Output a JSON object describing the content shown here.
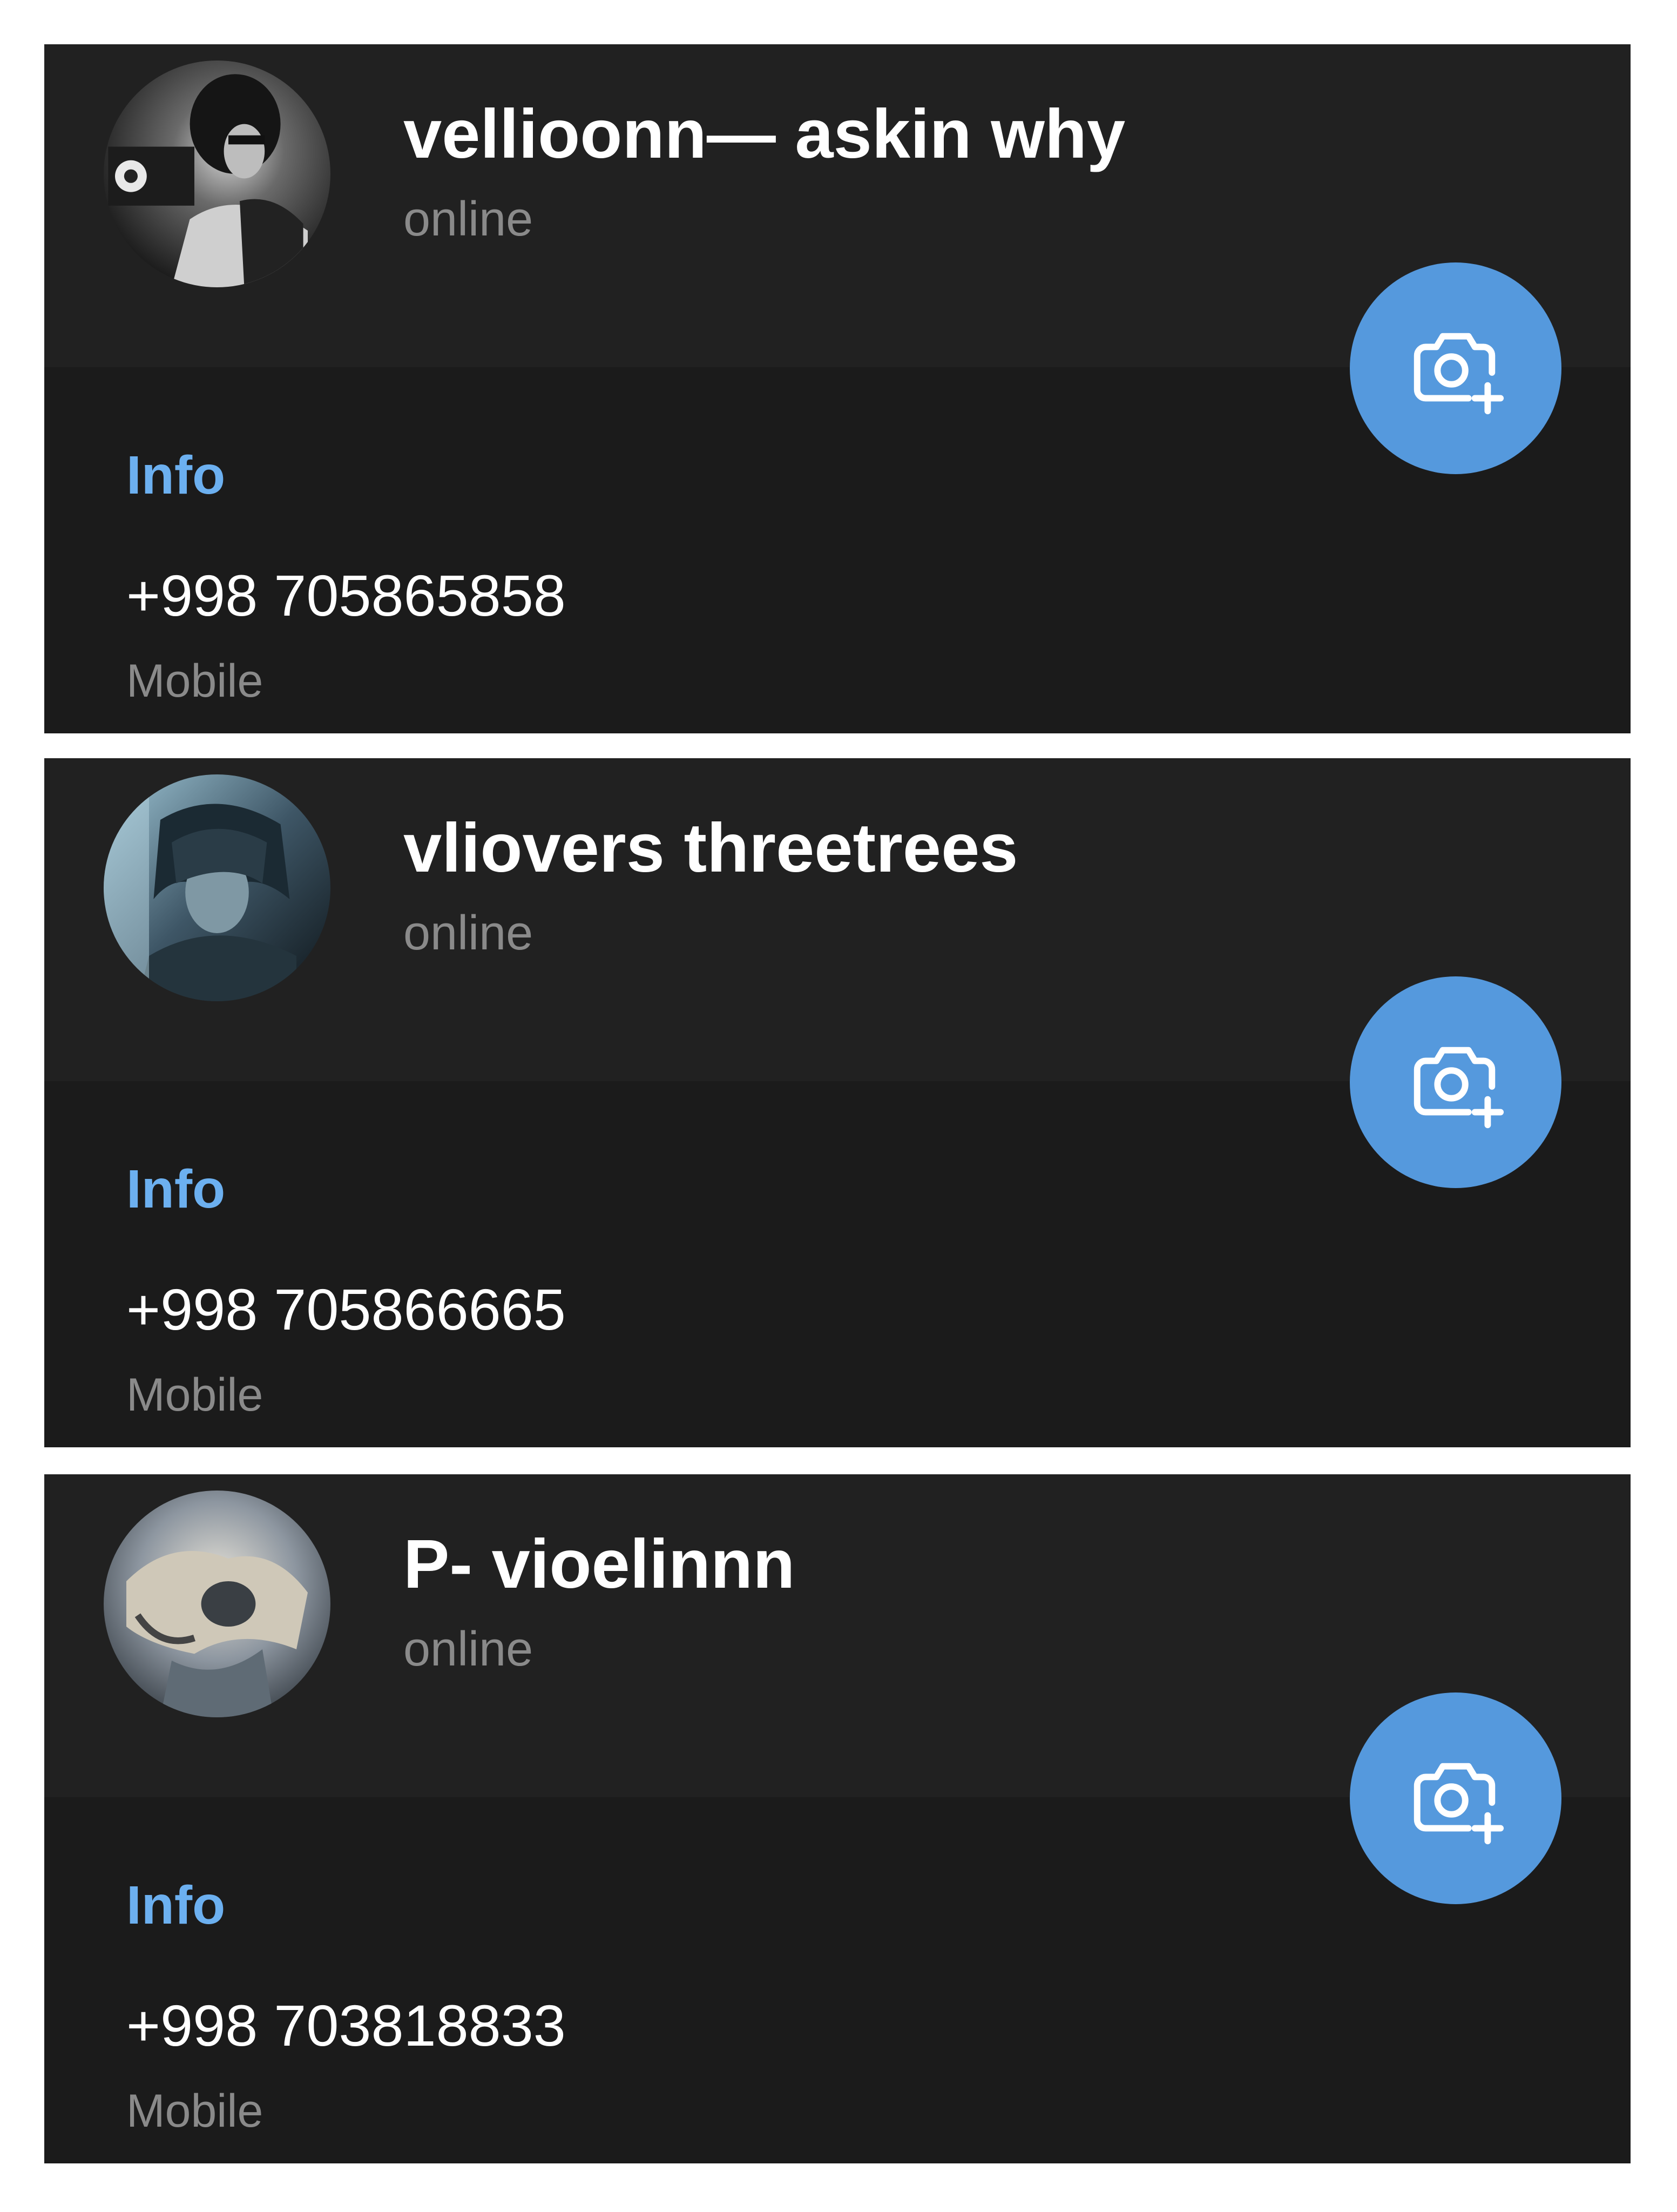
{
  "contacts": [
    {
      "name": "vellioonn— askin why",
      "status": "online",
      "info_label": "Info",
      "phone": "+998 705865858",
      "phone_type": "Mobile",
      "avatar_icon": "avatar-photo",
      "camera_icon": "add-photo-camera-icon"
    },
    {
      "name": "vliovers threetrees",
      "status": "online",
      "info_label": "Info",
      "phone": "+998 705866665",
      "phone_type": "Mobile",
      "avatar_icon": "avatar-photo",
      "camera_icon": "add-photo-camera-icon"
    },
    {
      "name": "P- vioelinnn",
      "status": "online",
      "info_label": "Info",
      "phone": "+998 703818833",
      "phone_type": "Mobile",
      "avatar_icon": "avatar-photo",
      "camera_icon": "add-photo-camera-icon"
    }
  ],
  "colors": {
    "header_bg": "#212121",
    "body_bg": "#1b1b1b",
    "accent": "#5599dd",
    "info_label": "#6cb0f0",
    "secondary_text": "#8a8a8a"
  }
}
